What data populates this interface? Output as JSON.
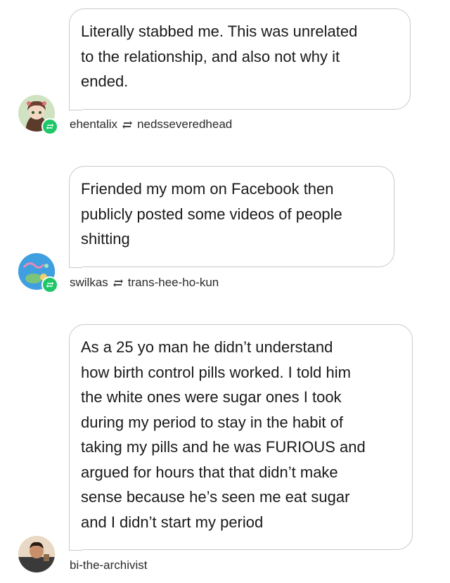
{
  "posts": [
    {
      "text_lines": [
        "Literally stabbed me. This was unrelated",
        "to the relationship, and also not why it",
        "ended."
      ],
      "author": "ehentalix",
      "reblogged_from": "nedsseveredhead",
      "is_reblog": true
    },
    {
      "text_lines": [
        "Friended my mom on Facebook then",
        "publicly posted some videos of people",
        "shitting"
      ],
      "author": "swilkas",
      "reblogged_from": "trans-hee-ho-kun",
      "is_reblog": true
    },
    {
      "text_lines": [
        "As a 25 yo man he didn’t understand",
        "how birth control pills worked. I told him",
        "the white ones were sugar ones I took",
        "during my period to stay in the habit of",
        "taking my pills and he was FURIOUS and",
        "argued for hours that that didn’t make",
        "sense because he’s seen me eat sugar",
        "and I didn’t start my period"
      ],
      "author": "bi-the-archivist",
      "reblogged_from": "",
      "is_reblog": false
    }
  ],
  "colors": {
    "reblog_badge": "#1ec768",
    "bubble_border": "#c9c9c9",
    "text": "#1a1a1a"
  },
  "icons": [
    "reblog-icon",
    "avatar"
  ]
}
